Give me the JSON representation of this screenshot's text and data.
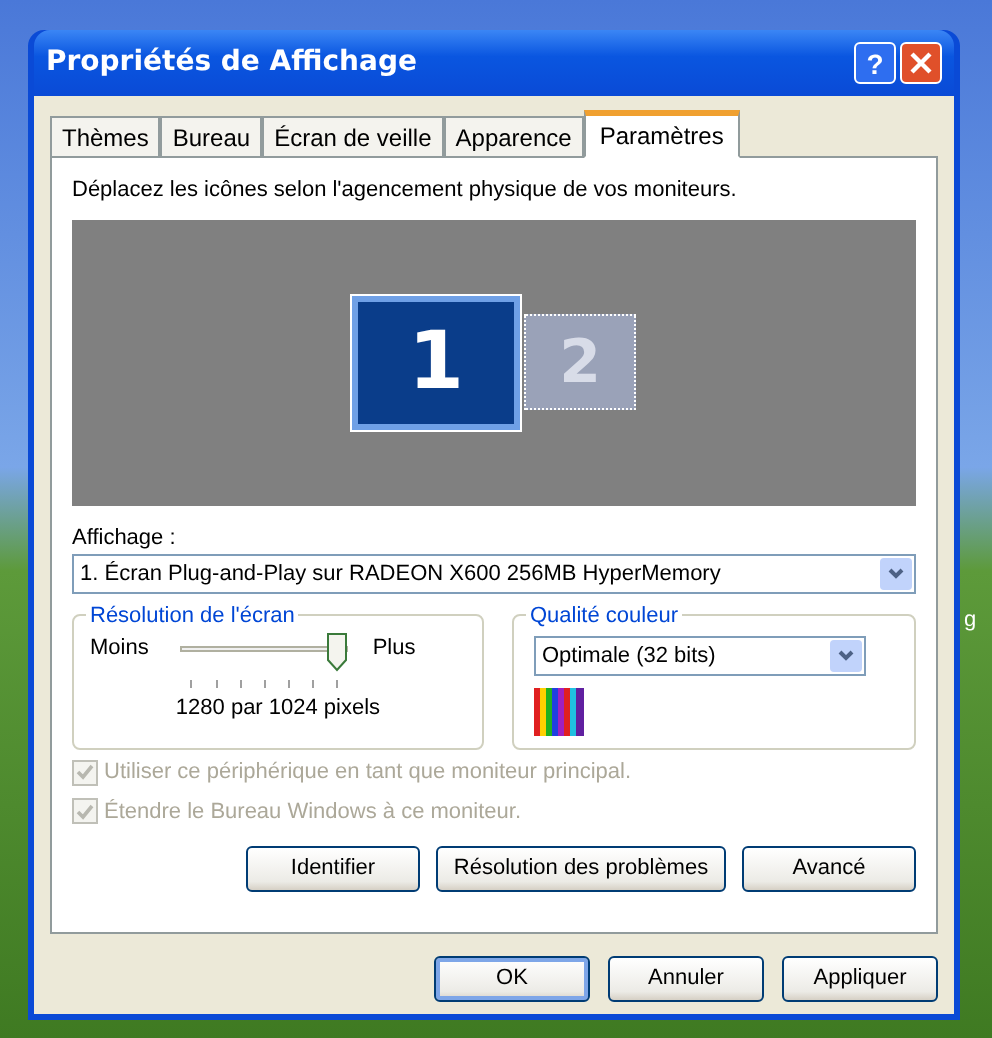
{
  "window": {
    "title": "Propriétés de Affichage",
    "help_button": "?"
  },
  "tabs": [
    {
      "label": "Thèmes",
      "selected": false
    },
    {
      "label": "Bureau",
      "selected": false
    },
    {
      "label": "Écran de veille",
      "selected": false
    },
    {
      "label": "Apparence",
      "selected": false
    },
    {
      "label": "Paramètres",
      "selected": true
    }
  ],
  "instruction": "Déplacez les icônes selon l'agencement physique de vos moniteurs.",
  "monitors": [
    {
      "label": "1",
      "selected": true
    },
    {
      "label": "2",
      "selected": false
    }
  ],
  "display": {
    "label": "Affichage :",
    "value": "1. Écran Plug-and-Play sur RADEON X600 256MB HyperMemory"
  },
  "resolution": {
    "title": "Résolution de l'écran",
    "min_label": "Moins",
    "max_label": "Plus",
    "level": 1,
    "reading": "1280 par 1024 pixels"
  },
  "color_quality": {
    "title": "Qualité couleur",
    "value": "Optimale (32 bits)"
  },
  "checkboxes": [
    {
      "label": "Utiliser ce périphérique en tant que moniteur principal.",
      "checked": true,
      "disabled": true
    },
    {
      "label": "Étendre le Bureau Windows à ce moniteur.",
      "checked": true,
      "disabled": true
    }
  ],
  "panel_buttons": [
    "Identifier",
    "Résolution des problèmes",
    "Avancé"
  ],
  "dialog_buttons": [
    {
      "label": "OK",
      "default": true
    },
    {
      "label": "Annuler",
      "default": false
    },
    {
      "label": "Appliquer",
      "default": false
    }
  ],
  "desktop_text": "g"
}
